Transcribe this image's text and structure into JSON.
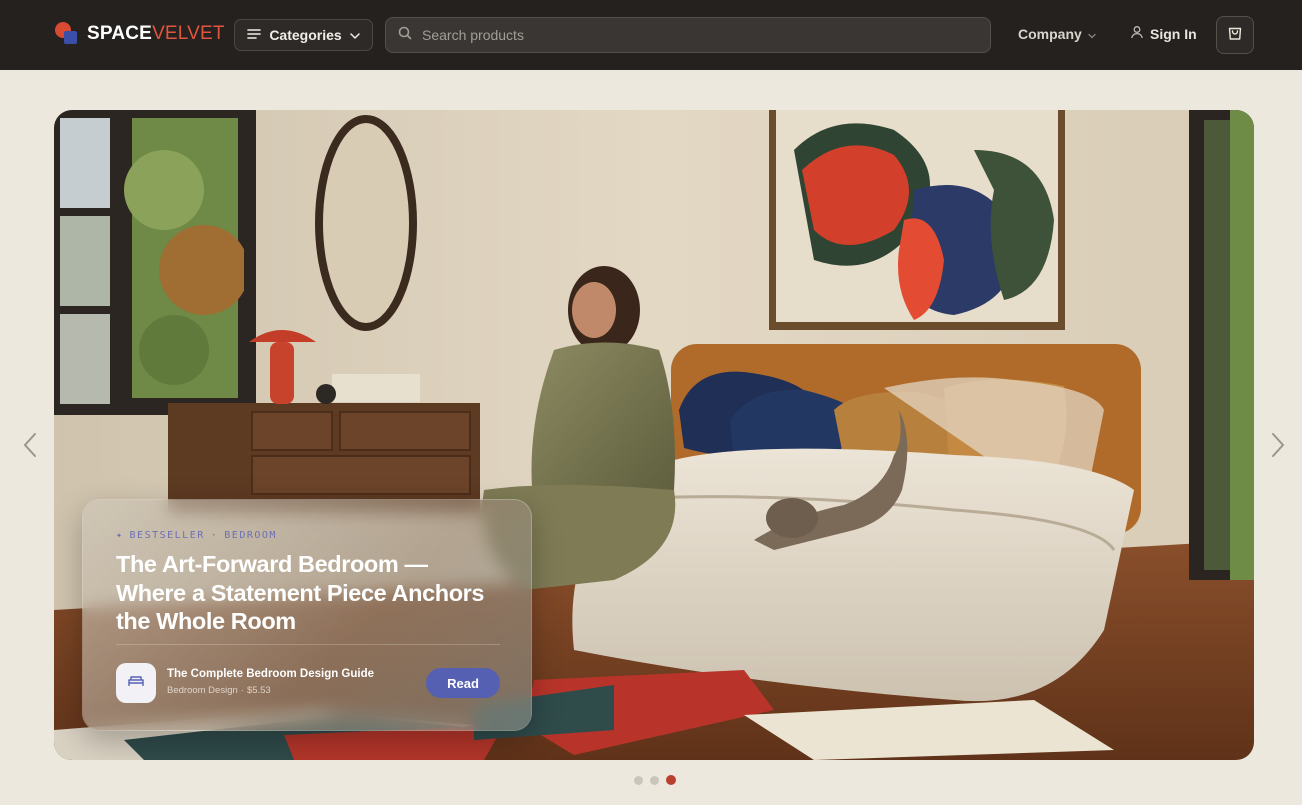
{
  "header": {
    "logo_part1": "SPACE",
    "logo_part2": "VELVET",
    "categories_label": "Categories",
    "search_placeholder": "Search products",
    "company_label": "Company",
    "signin_label": "Sign In"
  },
  "hero": {
    "eyebrow_badge": "BESTSELLER",
    "eyebrow_separator": "·",
    "eyebrow_category": "BEDROOM",
    "headline_line1": "The Art-Forward Bedroom —",
    "headline_line2": "Where a Statement Piece Anchors",
    "headline_line3": "the Whole Room",
    "guide_title": "The Complete Bedroom Design Guide",
    "guide_category": "Bedroom Design",
    "guide_sep": "·",
    "guide_price": "$5.53",
    "read_label": "Read"
  },
  "carousel": {
    "slide_count": 3,
    "active_slide": 3
  },
  "colors": {
    "accent": "#e0553d",
    "button": "#5660b3",
    "header_bg": "#24211f",
    "page_bg": "#ece8dd"
  },
  "icons": [
    "menu-icon",
    "chevron-down-icon",
    "search-icon",
    "user-icon",
    "shopping-bag-icon",
    "bed-icon",
    "chevron-left-icon",
    "chevron-right-icon",
    "sparkle-icon"
  ]
}
